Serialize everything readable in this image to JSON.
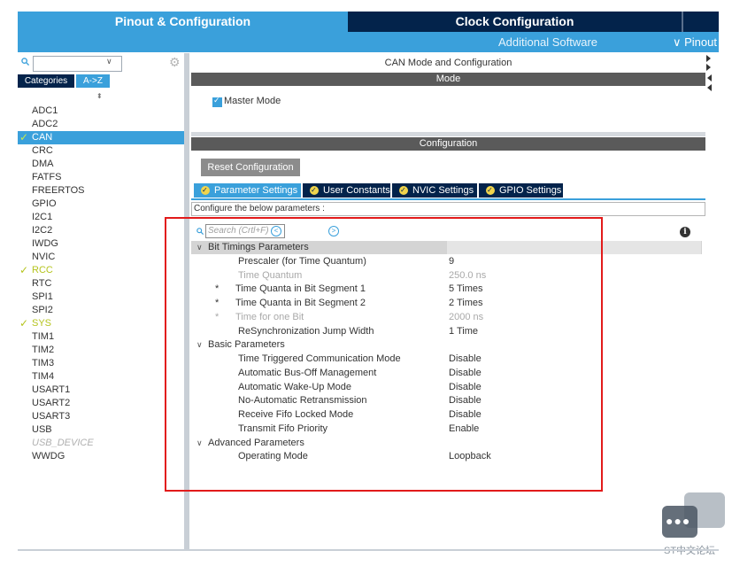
{
  "top_tabs": {
    "pinout": "Pinout & Configuration",
    "clock": "Clock Configuration"
  },
  "sub_tabs": {
    "additional": "Additional Software",
    "pinout": "∨ Pinout"
  },
  "left_panel": {
    "search": {
      "value": ""
    },
    "categories_label": "Categories",
    "az_label": "A->Z",
    "peripherals": [
      {
        "label": "ADC1",
        "state": "normal"
      },
      {
        "label": "ADC2",
        "state": "normal"
      },
      {
        "label": "CAN",
        "state": "selected"
      },
      {
        "label": "CRC",
        "state": "normal"
      },
      {
        "label": "DMA",
        "state": "normal"
      },
      {
        "label": "FATFS",
        "state": "normal"
      },
      {
        "label": "FREERTOS",
        "state": "normal"
      },
      {
        "label": "GPIO",
        "state": "normal"
      },
      {
        "label": "I2C1",
        "state": "normal"
      },
      {
        "label": "I2C2",
        "state": "normal"
      },
      {
        "label": "IWDG",
        "state": "normal"
      },
      {
        "label": "NVIC",
        "state": "normal"
      },
      {
        "label": "RCC",
        "state": "configured"
      },
      {
        "label": "RTC",
        "state": "normal"
      },
      {
        "label": "SPI1",
        "state": "normal"
      },
      {
        "label": "SPI2",
        "state": "normal"
      },
      {
        "label": "SYS",
        "state": "configured"
      },
      {
        "label": "TIM1",
        "state": "normal"
      },
      {
        "label": "TIM2",
        "state": "normal"
      },
      {
        "label": "TIM3",
        "state": "normal"
      },
      {
        "label": "TIM4",
        "state": "normal"
      },
      {
        "label": "USART1",
        "state": "normal"
      },
      {
        "label": "USART2",
        "state": "normal"
      },
      {
        "label": "USART3",
        "state": "normal"
      },
      {
        "label": "USB",
        "state": "normal"
      },
      {
        "label": "USB_DEVICE",
        "state": "disabled"
      },
      {
        "label": "WWDG",
        "state": "normal"
      }
    ]
  },
  "right_panel": {
    "mode_title": "CAN Mode and Configuration",
    "mode_header": "Mode",
    "master_mode": {
      "label": "Master Mode",
      "checked": true
    },
    "config_header": "Configuration",
    "reset_button": "Reset Configuration",
    "config_tabs": [
      {
        "label": "Parameter Settings",
        "active": true
      },
      {
        "label": "User Constants",
        "active": false
      },
      {
        "label": "NVIC Settings",
        "active": false
      },
      {
        "label": "GPIO Settings",
        "active": false
      }
    ],
    "configure_text": "Configure the below parameters :",
    "param_search_placeholder": "Search (Crtl+F)",
    "parameters": [
      {
        "type": "group",
        "label": "Bit Timings Parameters",
        "highlight": true
      },
      {
        "type": "param",
        "star": "",
        "name": "Prescaler (for Time Quantum)",
        "value": "9",
        "readonly": false
      },
      {
        "type": "param",
        "star": "",
        "name": "Time Quantum",
        "value": "250.0 ns",
        "readonly": true
      },
      {
        "type": "param",
        "star": "*",
        "name": "Time Quanta in Bit Segment 1",
        "value": "5 Times",
        "readonly": false
      },
      {
        "type": "param",
        "star": "*",
        "name": "Time Quanta in Bit Segment 2",
        "value": "2 Times",
        "readonly": false
      },
      {
        "type": "param",
        "star": "*",
        "name": "Time for one Bit",
        "value": "2000 ns",
        "readonly": true
      },
      {
        "type": "param",
        "star": "",
        "name": "ReSynchronization Jump Width",
        "value": "1 Time",
        "readonly": false
      },
      {
        "type": "group",
        "label": "Basic Parameters",
        "highlight": false
      },
      {
        "type": "param",
        "star": "",
        "name": "Time Triggered Communication Mode",
        "value": "Disable",
        "readonly": false
      },
      {
        "type": "param",
        "star": "",
        "name": "Automatic Bus-Off Management",
        "value": "Disable",
        "readonly": false
      },
      {
        "type": "param",
        "star": "",
        "name": "Automatic Wake-Up Mode",
        "value": "Disable",
        "readonly": false
      },
      {
        "type": "param",
        "star": "",
        "name": "No-Automatic Retransmission",
        "value": "Disable",
        "readonly": false
      },
      {
        "type": "param",
        "star": "",
        "name": "Receive Fifo Locked Mode",
        "value": "Disable",
        "readonly": false
      },
      {
        "type": "param",
        "star": "",
        "name": "Transmit Fifo Priority",
        "value": "Enable",
        "readonly": false
      },
      {
        "type": "group",
        "label": "Advanced Parameters",
        "highlight": false
      },
      {
        "type": "param",
        "star": "",
        "name": "Operating Mode",
        "value": "Loopback",
        "readonly": false
      }
    ]
  },
  "watermark": {
    "text": "ST中文论坛"
  },
  "colors": {
    "accent": "#3aa0db",
    "dark": "#03234b",
    "check": "#b5c41e",
    "annotation": "#e21b1b"
  }
}
